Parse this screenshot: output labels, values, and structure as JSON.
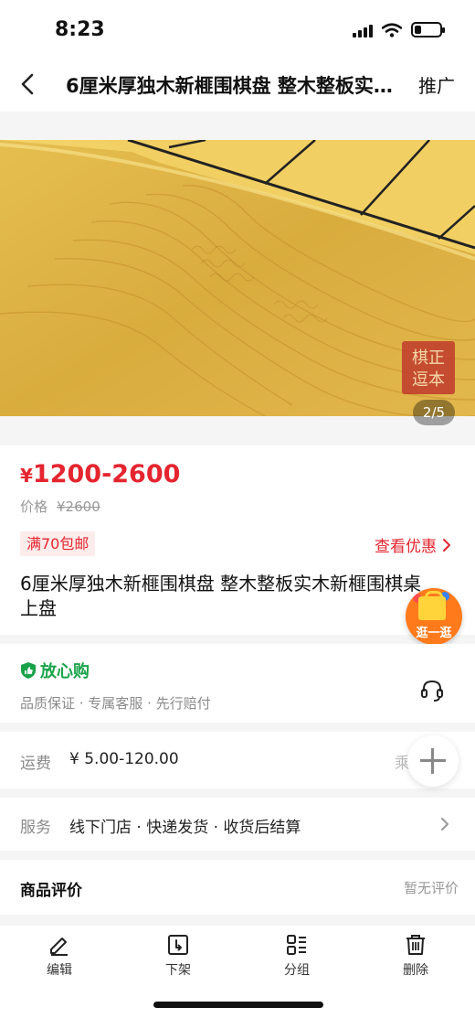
{
  "status_bar": {
    "time": "8:23"
  },
  "nav": {
    "title": "6厘米厚独木新榧围棋盘 整木整板实木新榧围棋桌上盘",
    "promote_label": "推广"
  },
  "hero": {
    "page_indicator": "2/5",
    "seal_text": "棋正本逗"
  },
  "price_card": {
    "currency": "¥",
    "price_range": "1200-2600",
    "orig_label": "价格",
    "orig_price": "¥2600",
    "shipping_badge": "满70包邮",
    "promo_link": "查看优惠",
    "product_title": "6厘米厚独木新榧围棋盘 整木整板实木新榧围棋桌上盘"
  },
  "float_shop": {
    "label": "逛一逛"
  },
  "assurance": {
    "title": "放心购",
    "subtitle": "品质保证 · 专属客服 · 先行赔付"
  },
  "freight": {
    "label": "运费",
    "value": "¥ 5.00-120.00",
    "tail": "乘"
  },
  "service": {
    "label": "服务",
    "value": "线下门店 · 快递发货 · 收货后结算"
  },
  "reviews": {
    "title": "商品评价",
    "empty": "暂无评价"
  },
  "toolbar": {
    "items": [
      {
        "label": "编辑",
        "icon": "edit-icon"
      },
      {
        "label": "下架",
        "icon": "delist-icon"
      },
      {
        "label": "分组",
        "icon": "group-icon"
      },
      {
        "label": "删除",
        "icon": "delete-icon"
      }
    ]
  },
  "colors": {
    "accent_red": "#e4252f",
    "assure_green": "#1aa34a",
    "wood": "#e0b94a"
  }
}
